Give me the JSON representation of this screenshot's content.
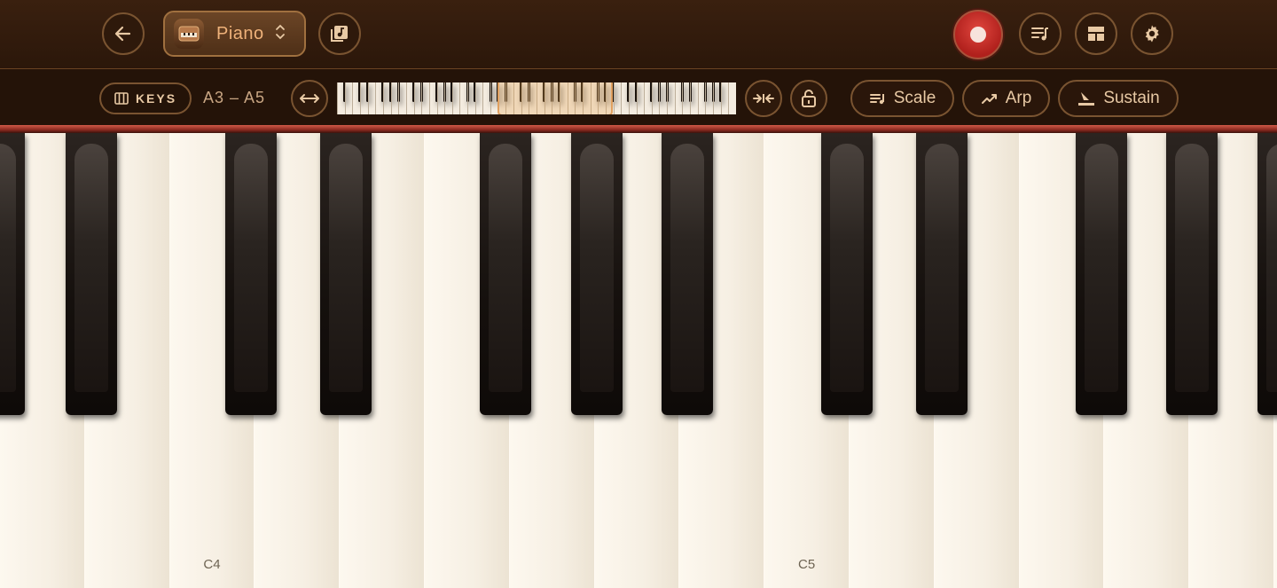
{
  "header": {
    "instrument_name": "Piano",
    "back_icon": "arrow-left-icon",
    "instrument_picker_icon": "chevron-updown-icon",
    "library_icon": "music-library-icon",
    "record_icon": "record-icon",
    "playlist_icon": "playlist-icon",
    "layout_icon": "layout-icon",
    "settings_icon": "gear-icon",
    "record_color": "#d02a24"
  },
  "toolbar": {
    "keys_label": "KEYS",
    "range_label": "A3 – A5",
    "scale_label": "Scale",
    "arp_label": "Arp",
    "sustain_label": "Sustain",
    "expand_icon": "arrows-horizontal-icon",
    "compress_icon": "arrows-inward-icon",
    "lock_icon": "unlock-icon"
  },
  "keyboard": {
    "labels": {
      "c4": "C4",
      "c5": "C5"
    },
    "accent": "#e0a060"
  }
}
